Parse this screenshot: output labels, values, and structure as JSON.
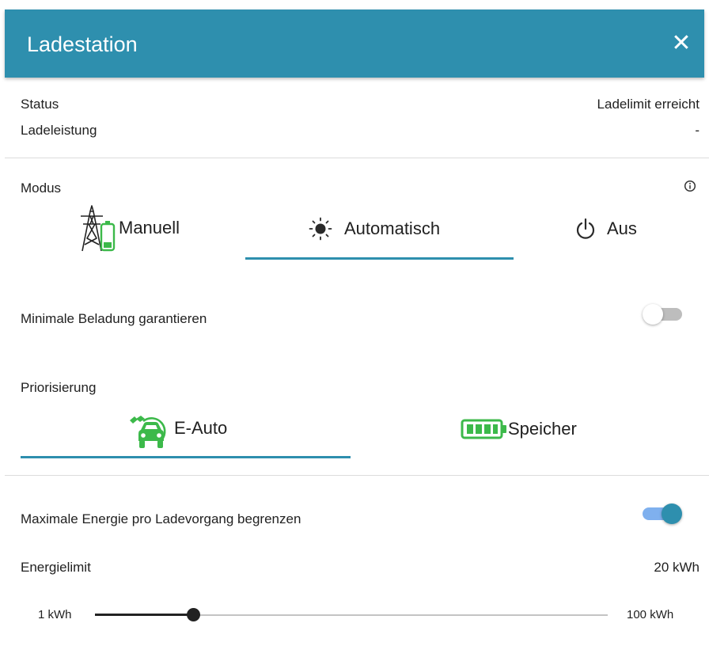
{
  "header": {
    "title": "Ladestation",
    "close_glyph": "✕"
  },
  "status": {
    "status_label": "Status",
    "status_value": "Ladelimit erreicht",
    "power_label": "Ladeleistung",
    "power_value": "-"
  },
  "mode": {
    "label": "Modus",
    "info_icon": "info-circle-icon",
    "tabs": [
      {
        "label": "Manuell",
        "icon": "power-pylon-battery-icon",
        "selected": false
      },
      {
        "label": "Automatisch",
        "icon": "sun-icon",
        "selected": true
      },
      {
        "label": "Aus",
        "icon": "power-icon",
        "selected": false
      }
    ]
  },
  "min_charge": {
    "label": "Minimale Beladung garantieren",
    "enabled": false
  },
  "priority": {
    "label": "Priorisierung",
    "tabs": [
      {
        "label": "E-Auto",
        "icon": "ev-car-plug-icon",
        "selected": true
      },
      {
        "label": "Speicher",
        "icon": "battery-icon",
        "selected": false
      }
    ]
  },
  "max_energy": {
    "label": "Maximale Energie pro Ladevorgang begrenzen",
    "enabled": true
  },
  "energy_limit": {
    "label": "Energielimit",
    "value_text": "20 kWh",
    "min_label": "1 kWh",
    "max_label": "100 kWh",
    "min": 1,
    "max": 100,
    "value": 20
  },
  "colors": {
    "accent": "#2e8fae",
    "accent_light": "#7fb0ee",
    "green": "#3cb94a",
    "switch_off_knob": "#ffffff",
    "switch_off_track": "#bdbdbd"
  }
}
